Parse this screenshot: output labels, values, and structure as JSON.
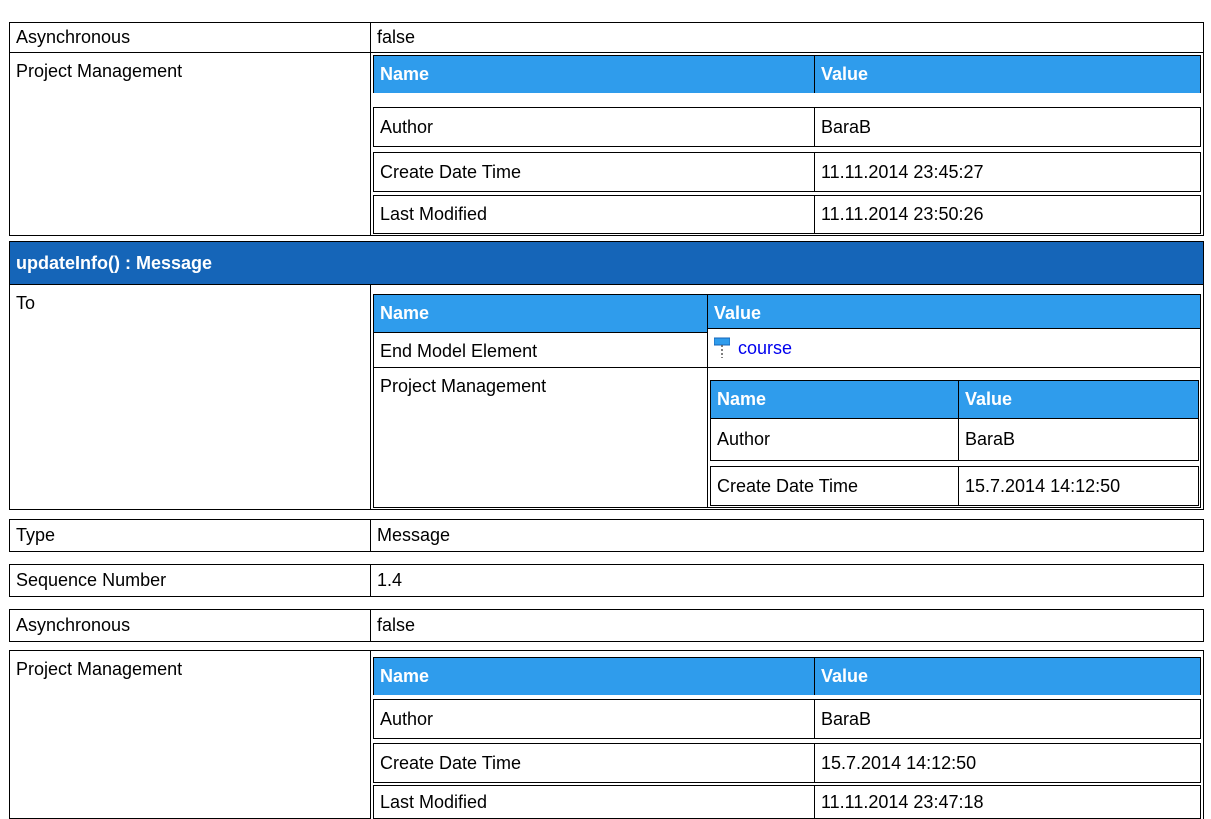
{
  "block1": {
    "asynchronous": {
      "label": "Asynchronous",
      "value": "false"
    },
    "project_management": {
      "label": "Project Management",
      "headers": {
        "name": "Name",
        "value": "Value"
      },
      "rows": [
        {
          "name": "Author",
          "value": "BaraB"
        },
        {
          "name": "Create Date Time",
          "value": "11.11.2014 23:45:27"
        },
        {
          "name": "Last Modified",
          "value": "11.11.2014 23:50:26"
        }
      ]
    }
  },
  "message": {
    "title": "updateInfo() : Message",
    "to": {
      "label": "To",
      "headers": {
        "name": "Name",
        "value": "Value"
      },
      "end_model_element": {
        "name": "End Model Element",
        "value": "course",
        "icon": "lifeline-icon"
      },
      "project_management": {
        "label": "Project Management",
        "headers": {
          "name": "Name",
          "value": "Value"
        },
        "rows": [
          {
            "name": "Author",
            "value": "BaraB"
          },
          {
            "name": "Create Date Time",
            "value": "15.7.2014 14:12:50"
          }
        ]
      }
    },
    "type": {
      "label": "Type",
      "value": "Message"
    },
    "sequence_number": {
      "label": "Sequence Number",
      "value": "1.4"
    },
    "asynchronous": {
      "label": "Asynchronous",
      "value": "false"
    },
    "project_management": {
      "label": "Project Management",
      "headers": {
        "name": "Name",
        "value": "Value"
      },
      "rows": [
        {
          "name": "Author",
          "value": "BaraB"
        },
        {
          "name": "Create Date Time",
          "value": "15.7.2014 14:12:50"
        },
        {
          "name": "Last Modified",
          "value": "11.11.2014 23:47:18"
        }
      ]
    }
  }
}
